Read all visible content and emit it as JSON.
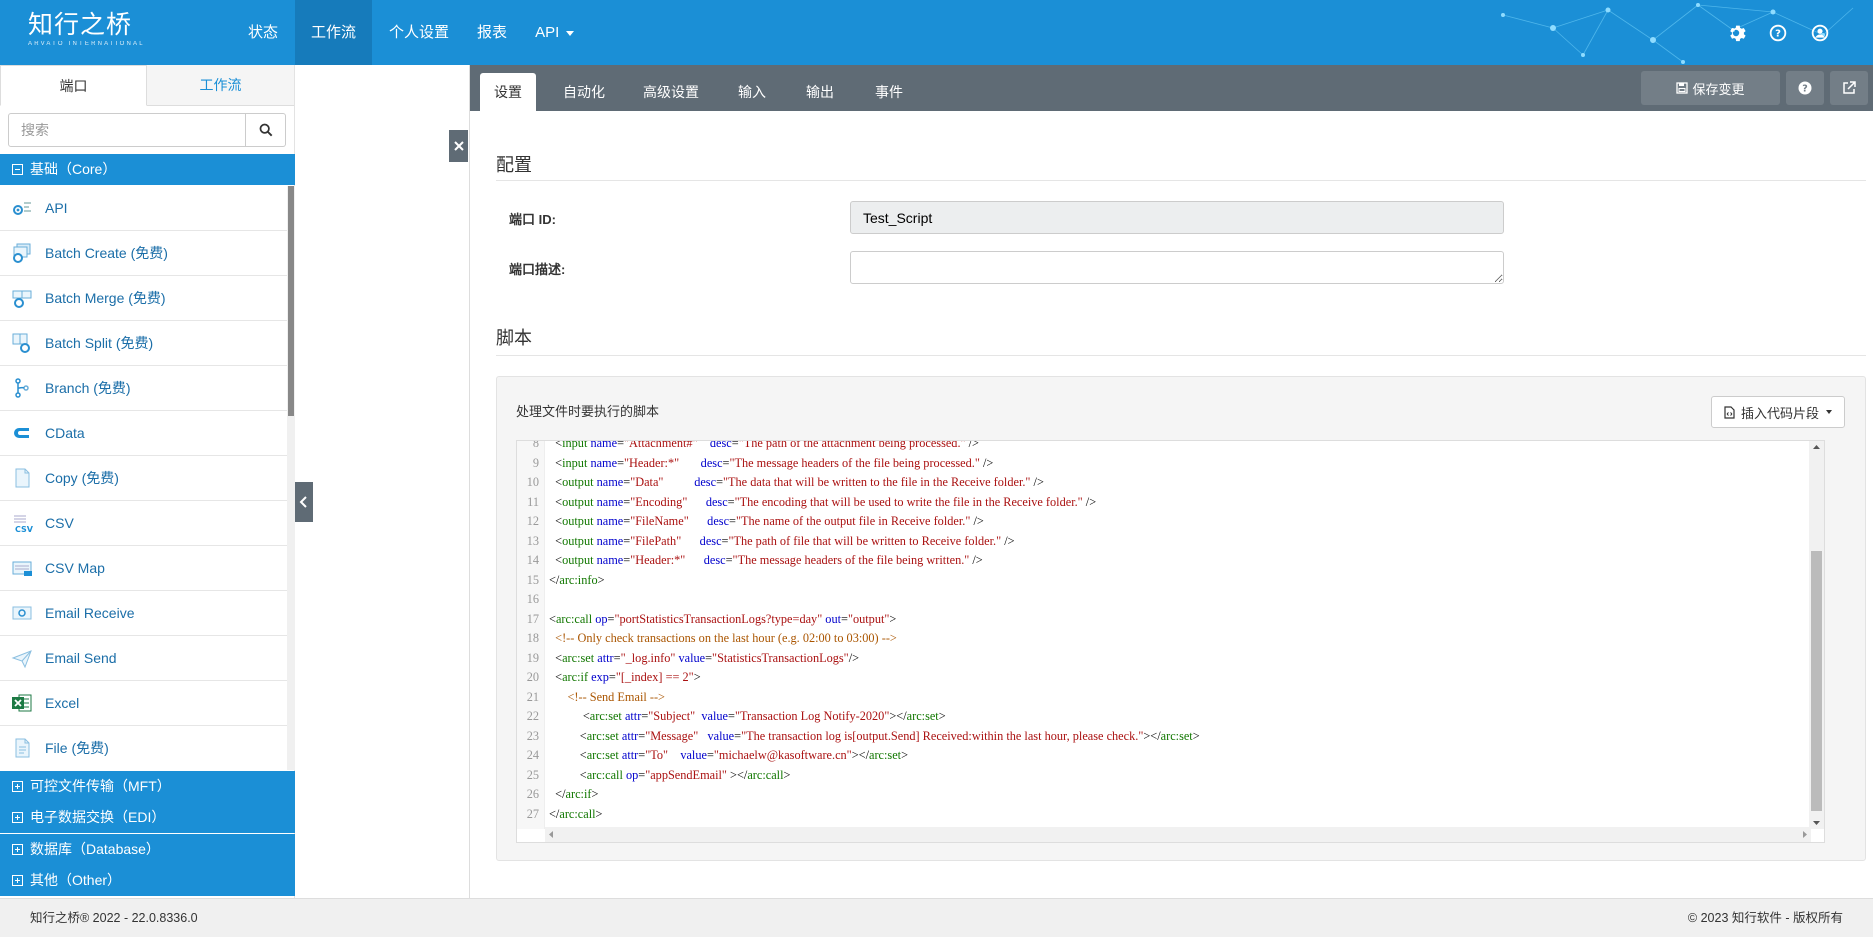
{
  "brand": {
    "name": "知行之桥",
    "sub": "ARVATO INTERNATIONAL"
  },
  "nav": {
    "items": [
      {
        "label": "状态",
        "active": false
      },
      {
        "label": "工作流",
        "active": true
      },
      {
        "label": "个人设置",
        "active": false
      },
      {
        "label": "报表",
        "active": false
      },
      {
        "label": "API",
        "active": false,
        "dropdown": true
      }
    ],
    "icons": [
      "gear-icon",
      "help-icon",
      "user-icon"
    ]
  },
  "sidebar": {
    "tabs": [
      {
        "label": "端口",
        "active": true
      },
      {
        "label": "工作流",
        "active": false
      }
    ],
    "search_placeholder": "搜索",
    "core_group": "基础（Core）",
    "items": [
      {
        "label": "API",
        "icon": "api-icon"
      },
      {
        "label": "Batch Create (免费)",
        "icon": "batch-create-icon"
      },
      {
        "label": "Batch Merge (免费)",
        "icon": "batch-merge-icon"
      },
      {
        "label": "Batch Split (免费)",
        "icon": "batch-split-icon"
      },
      {
        "label": "Branch (免费)",
        "icon": "branch-icon"
      },
      {
        "label": "CData",
        "icon": "cdata-icon"
      },
      {
        "label": "Copy (免费)",
        "icon": "copy-icon"
      },
      {
        "label": "CSV",
        "icon": "csv-icon"
      },
      {
        "label": "CSV Map",
        "icon": "csv-map-icon"
      },
      {
        "label": "Email Receive",
        "icon": "email-receive-icon"
      },
      {
        "label": "Email Send",
        "icon": "email-send-icon"
      },
      {
        "label": "Excel",
        "icon": "excel-icon"
      },
      {
        "label": "File (免费)",
        "icon": "file-icon"
      }
    ],
    "other_groups": [
      "可控文件传输（MFT）",
      "电子数据交换（EDI）",
      "数据库（Database）",
      "其他（Other）"
    ]
  },
  "panel": {
    "tabs": [
      {
        "label": "设置",
        "active": true
      },
      {
        "label": "自动化",
        "active": false
      },
      {
        "label": "高级设置",
        "active": false
      },
      {
        "label": "输入",
        "active": false
      },
      {
        "label": "输出",
        "active": false
      },
      {
        "label": "事件",
        "active": false
      }
    ],
    "save_label": "保存变更",
    "config_title": "配置",
    "port_id_label": "端口 ID:",
    "port_id_value": "Test_Script",
    "port_desc_label": "端口描述:",
    "port_desc_value": "",
    "script_title": "脚本",
    "script_label": "处理文件时要执行的脚本",
    "snippet_label": "插入代码片段",
    "code": [
      {
        "n": "8",
        "text": "  <input name=\"Attachment#\"    desc=\"The path of the attachment being processed.\" />"
      },
      {
        "n": "9",
        "text": "  <input name=\"Header:*\"       desc=\"The message headers of the file being processed.\" />"
      },
      {
        "n": "10",
        "text": "  <output name=\"Data\"          desc=\"The data that will be written to the file in the Receive folder.\" />"
      },
      {
        "n": "11",
        "text": "  <output name=\"Encoding\"      desc=\"The encoding that will be used to write the file in the Receive folder.\" />"
      },
      {
        "n": "12",
        "text": "  <output name=\"FileName\"      desc=\"The name of the output file in Receive folder.\" />"
      },
      {
        "n": "13",
        "text": "  <output name=\"FilePath\"      desc=\"The path of file that will be written to Receive folder.\" />"
      },
      {
        "n": "14",
        "text": "  <output name=\"Header:*\"      desc=\"The message headers of the file being written.\" />"
      },
      {
        "n": "15",
        "text": "</arc:info>"
      },
      {
        "n": "16",
        "text": ""
      },
      {
        "n": "17",
        "text": "<arc:call op=\"portStatisticsTransactionLogs?type=day\" out=\"output\">"
      },
      {
        "n": "18",
        "text": "  <!-- Only check transactions on the last hour (e.g. 02:00 to 03:00) -->"
      },
      {
        "n": "19",
        "text": "  <arc:set attr=\"_log.info\" value=\"StatisticsTransactionLogs\"/>"
      },
      {
        "n": "20",
        "text": "  <arc:if exp=\"[_index] == 2\">"
      },
      {
        "n": "21",
        "text": "      <!-- Send Email -->"
      },
      {
        "n": "22",
        "text": "           <arc:set attr=\"Subject\"  value=\"Transaction Log Notify-2020\"></arc:set>"
      },
      {
        "n": "23",
        "text": "          <arc:set attr=\"Message\"   value=\"The transaction log is[output.Send] Received:within the last hour, please check.\"></arc:set>"
      },
      {
        "n": "24",
        "text": "          <arc:set attr=\"To\"    value=\"michaelw@kasoftware.cn\"></arc:set>"
      },
      {
        "n": "25",
        "text": "          <arc:call op=\"appSendEmail\" ></arc:call>"
      },
      {
        "n": "26",
        "text": "  </arc:if>"
      },
      {
        "n": "27",
        "text": "</arc:call>"
      }
    ]
  },
  "footer": {
    "left": "知行之桥® 2022 - 22.0.8336.0",
    "right": "© 2023 知行软件 - 版权所有"
  },
  "colors": {
    "brand": "#1b8fd6",
    "panel_bar": "#5f6b75",
    "link": "#1b6ea8"
  }
}
